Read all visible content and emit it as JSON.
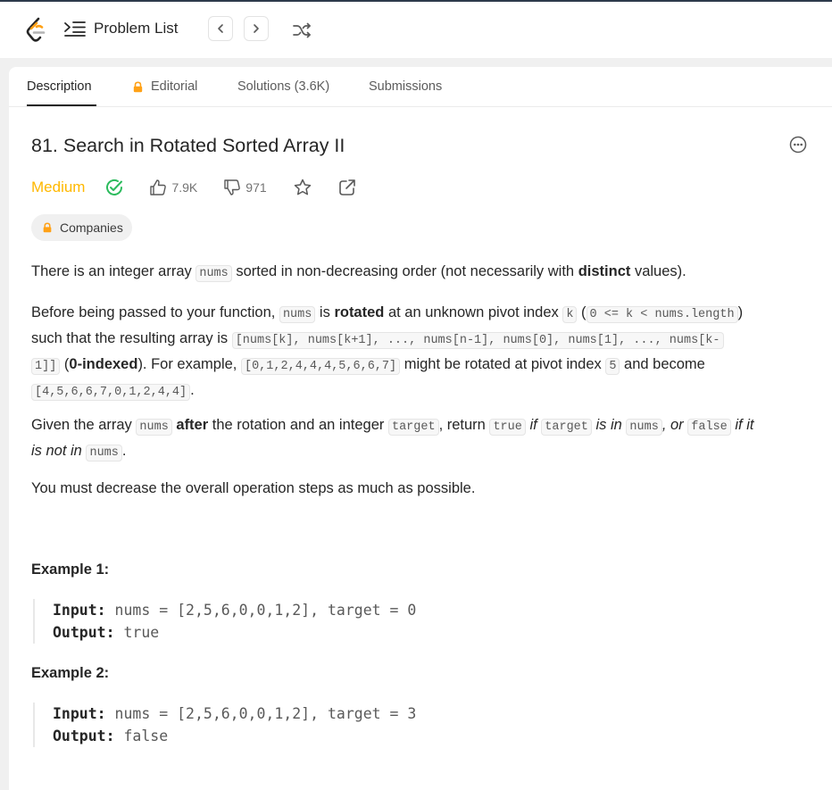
{
  "header": {
    "problem_list_label": "Problem List",
    "logo_icon": "leetcode-logo-icon",
    "prev_icon": "chevron-left-icon",
    "next_icon": "chevron-right-icon",
    "shuffle_icon": "shuffle-icon",
    "topline_color": "#2d3a4b"
  },
  "tabs": [
    {
      "label": "Description",
      "active": true
    },
    {
      "label": "Editorial",
      "locked": true
    },
    {
      "label": "Solutions (3.6K)"
    },
    {
      "label": "Submissions"
    }
  ],
  "problem": {
    "title": "81. Search in Rotated Sorted Array II",
    "difficulty": "Medium",
    "difficulty_color": "#ffb800",
    "solved_color": "#2cbb5d",
    "likes": "7.9K",
    "dislikes": "971",
    "companies_label": "Companies",
    "lock_color": "#ffa116"
  },
  "description": {
    "p1": {
      "t1": "There is an integer array ",
      "c1": "nums",
      "t2": " sorted in non-decreasing order (not necessarily with ",
      "b1": "distinct",
      "t3": " values)."
    },
    "p2": {
      "t1": "Before being passed to your function, ",
      "c1": "nums",
      "t2": " is ",
      "b1": "rotated",
      "t3": " at an unknown pivot index ",
      "c2": "k",
      "t4": " (",
      "c3": "0 <= k < nums.length",
      "t5": ")",
      "t6": "such that the resulting array is ",
      "c4": "[nums[k], nums[k+1], ..., nums[n-1], nums[0], nums[1], ..., nums[k-",
      "c5": "1]]",
      "t7": " (",
      "b2": "0-indexed",
      "t8": "). For example, ",
      "c6": "[0,1,2,4,4,4,5,6,6,7]",
      "t9": " might be rotated at pivot index ",
      "c7": "5",
      "t10": " and become",
      "c8": "[4,5,6,6,7,0,1,2,4,4]",
      "t11": "."
    },
    "p3": {
      "t1": "Given the array ",
      "c1": "nums",
      "t2": " ",
      "b1": "after",
      "t3": " the rotation and an integer ",
      "c2": "target",
      "t4": ", return ",
      "c3": "true",
      "t5": " ",
      "i1": "if",
      "t6": " ",
      "c4": "target",
      "t7": " ",
      "i2": "is in",
      "t8": " ",
      "c5": "nums",
      "i3": ", or",
      "t9": " ",
      "c6": "false",
      "t10": " ",
      "i4": "if it",
      "i5": "is not in",
      "t11": " ",
      "c7": "nums",
      "t12": "."
    },
    "p4": "You must decrease the overall operation steps as much as possible."
  },
  "examples": [
    {
      "heading": "Example 1:",
      "input_label": "Input:",
      "input": "nums = [2,5,6,0,0,1,2], target = 0",
      "output_label": "Output:",
      "output": "true"
    },
    {
      "heading": "Example 2:",
      "input_label": "Input:",
      "input": "nums = [2,5,6,0,0,1,2], target = 3",
      "output_label": "Output:",
      "output": "false"
    }
  ]
}
